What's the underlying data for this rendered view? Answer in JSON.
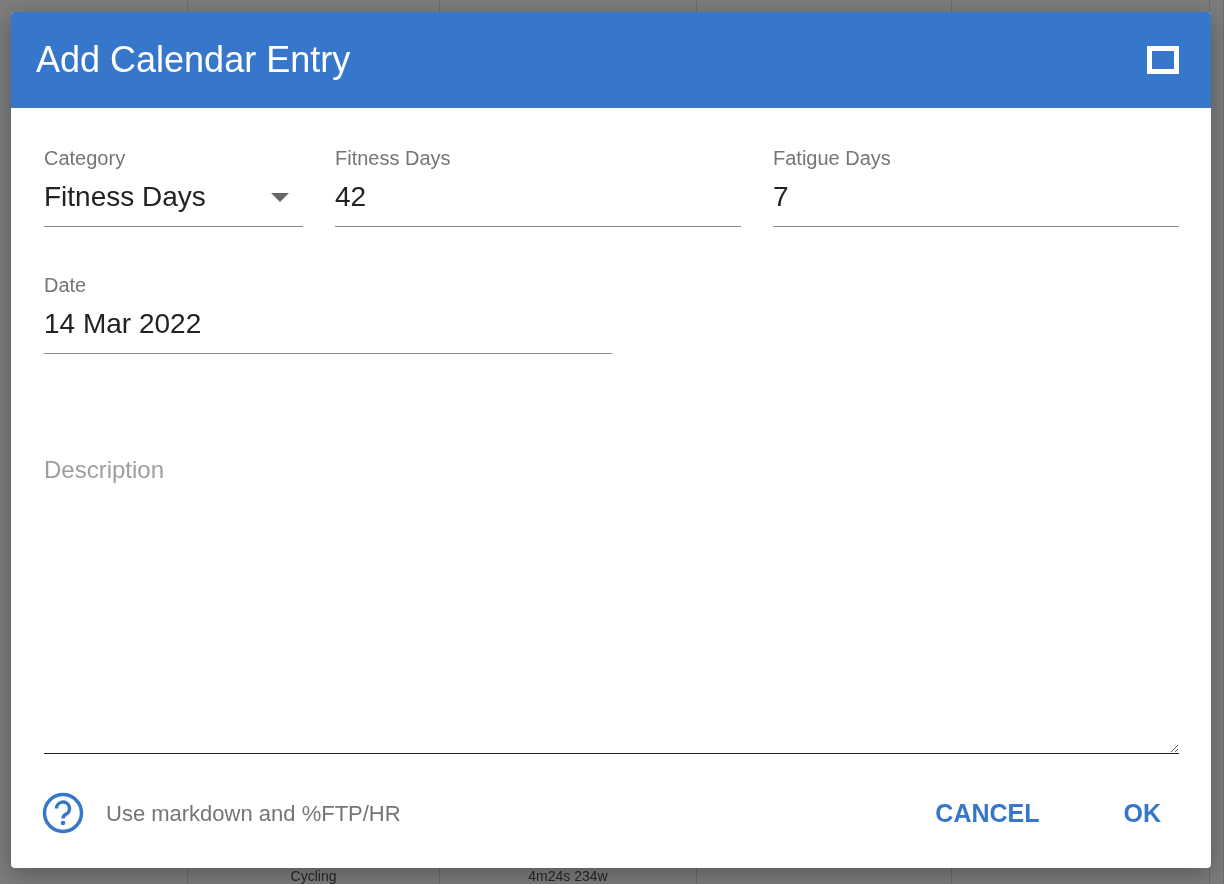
{
  "background": {
    "cells": [
      {
        "text": "Cycling"
      },
      {
        "text": "4m24s 234w"
      }
    ]
  },
  "dialog": {
    "title": "Add Calendar Entry",
    "fields": [
      {
        "kind": "select",
        "label": "Category",
        "value": "Fitness Days"
      },
      {
        "kind": "text",
        "label": "Fitness Days",
        "value": "42"
      },
      {
        "kind": "text",
        "label": "Fatigue Days",
        "value": "7"
      },
      {
        "kind": "text",
        "label": "Date",
        "value": "14 Mar 2022"
      }
    ],
    "description": {
      "placeholder": "Description"
    },
    "help_text": "Use markdown and %FTP/HR",
    "buttons": [
      "CANCEL",
      "OK"
    ]
  }
}
